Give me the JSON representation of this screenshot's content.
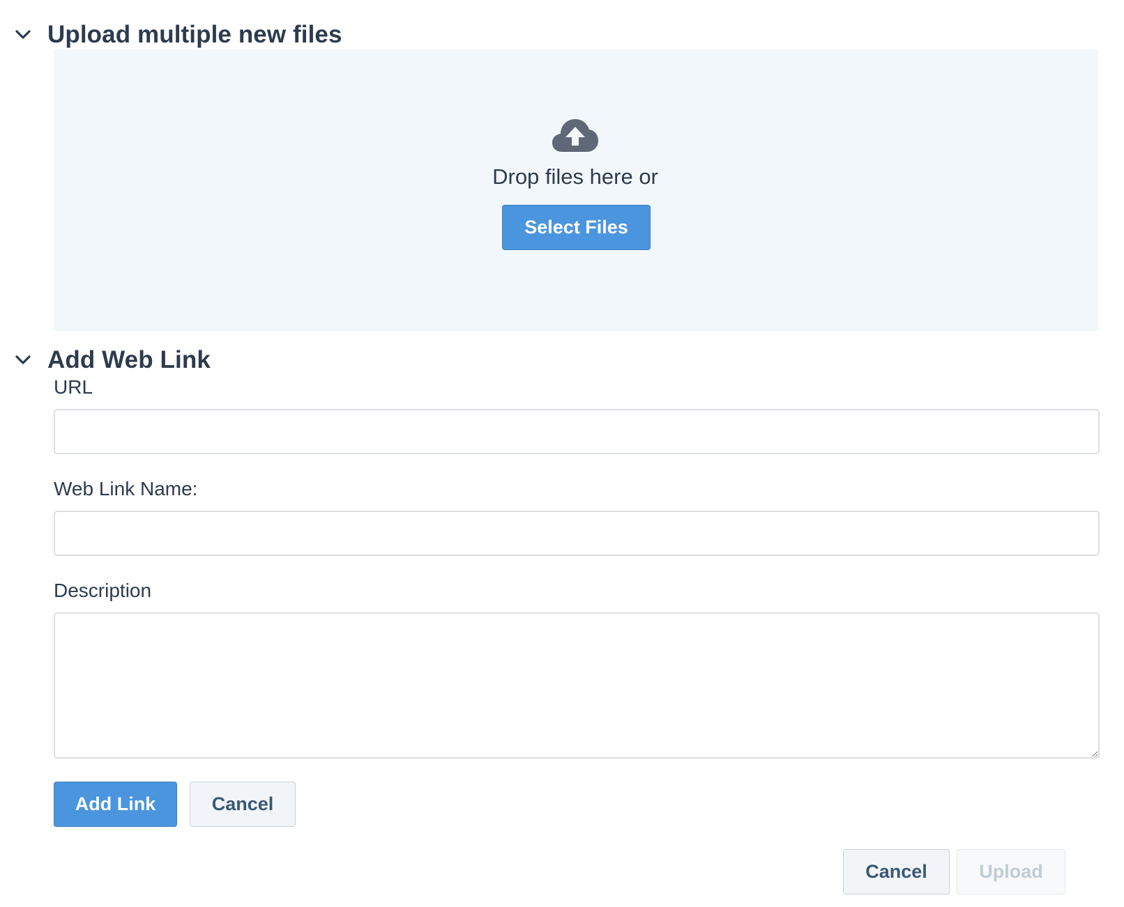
{
  "upload_section": {
    "title": "Upload multiple new files",
    "expanded": true,
    "chevron_icon": "chevron-down-icon",
    "dropzone": {
      "icon": "cloud-upload-icon",
      "text": "Drop files here or",
      "select_button_label": "Select Files"
    }
  },
  "weblink_section": {
    "title": "Add Web Link",
    "expanded": true,
    "chevron_icon": "chevron-down-icon",
    "url": {
      "label": "URL",
      "value": "",
      "placeholder": ""
    },
    "name": {
      "label": "Web Link Name:",
      "value": "",
      "placeholder": ""
    },
    "description": {
      "label": "Description",
      "value": "",
      "placeholder": ""
    },
    "add_button_label": "Add Link",
    "cancel_button_label": "Cancel"
  },
  "footer": {
    "cancel_label": "Cancel",
    "upload_label": "Upload",
    "upload_disabled": true
  },
  "colors": {
    "primary": "#4a95dd",
    "dropzone_bg": "#f2f7fb",
    "text": "#2d3b4e",
    "icon": "#5f6876"
  }
}
